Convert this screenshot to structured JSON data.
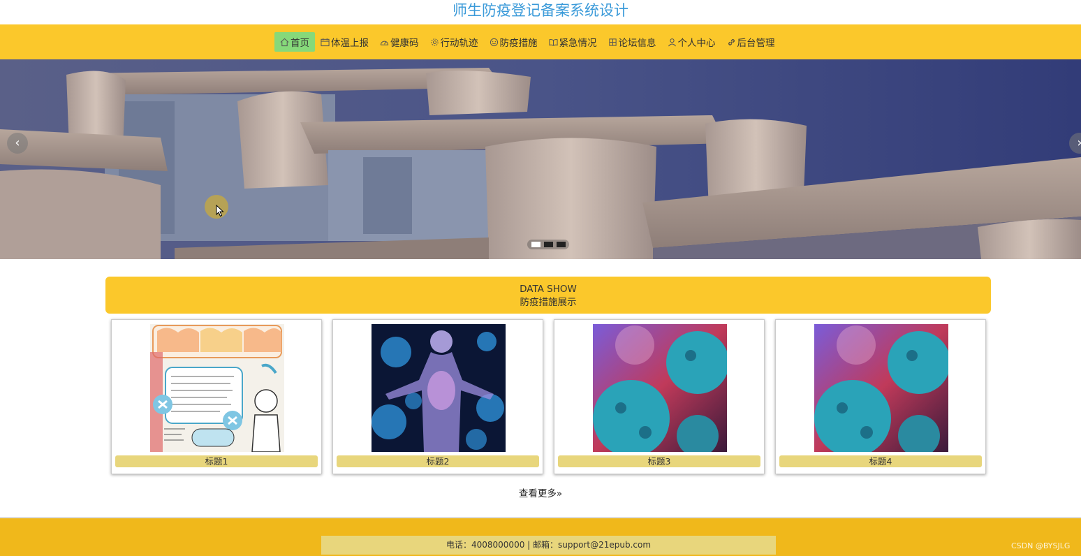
{
  "site": {
    "title": "师生防疫登记备案系统设计"
  },
  "nav": {
    "items": [
      {
        "label": "首页",
        "icon": "home-icon"
      },
      {
        "label": "体温上报",
        "icon": "calendar-icon"
      },
      {
        "label": "健康码",
        "icon": "gauge-icon"
      },
      {
        "label": "行动轨迹",
        "icon": "settings-icon"
      },
      {
        "label": "防疫措施",
        "icon": "smile-icon"
      },
      {
        "label": "紧急情况",
        "icon": "book-icon"
      },
      {
        "label": "论坛信息",
        "icon": "grid-icon"
      },
      {
        "label": "个人中心",
        "icon": "user-icon"
      },
      {
        "label": "后台管理",
        "icon": "link-icon"
      }
    ],
    "active_index": 0
  },
  "banner": {
    "slide_count": 3,
    "active_slide": 0
  },
  "section": {
    "title_en": "DATA SHOW",
    "title_cn": "防疫措施展示"
  },
  "cards": [
    {
      "caption": "标题1"
    },
    {
      "caption": "标题2"
    },
    {
      "caption": "标题3"
    },
    {
      "caption": "标题4"
    }
  ],
  "more": {
    "label": "查看更多"
  },
  "footer": {
    "contact": "电话：4008000000 | 邮箱：support@21epub.com"
  },
  "watermark": "CSDN @BYSJLG",
  "colors": {
    "accent": "#fbc82b",
    "active_nav": "#86d97a",
    "caption_bg": "#e8d67c",
    "title": "#3a9ad9"
  }
}
